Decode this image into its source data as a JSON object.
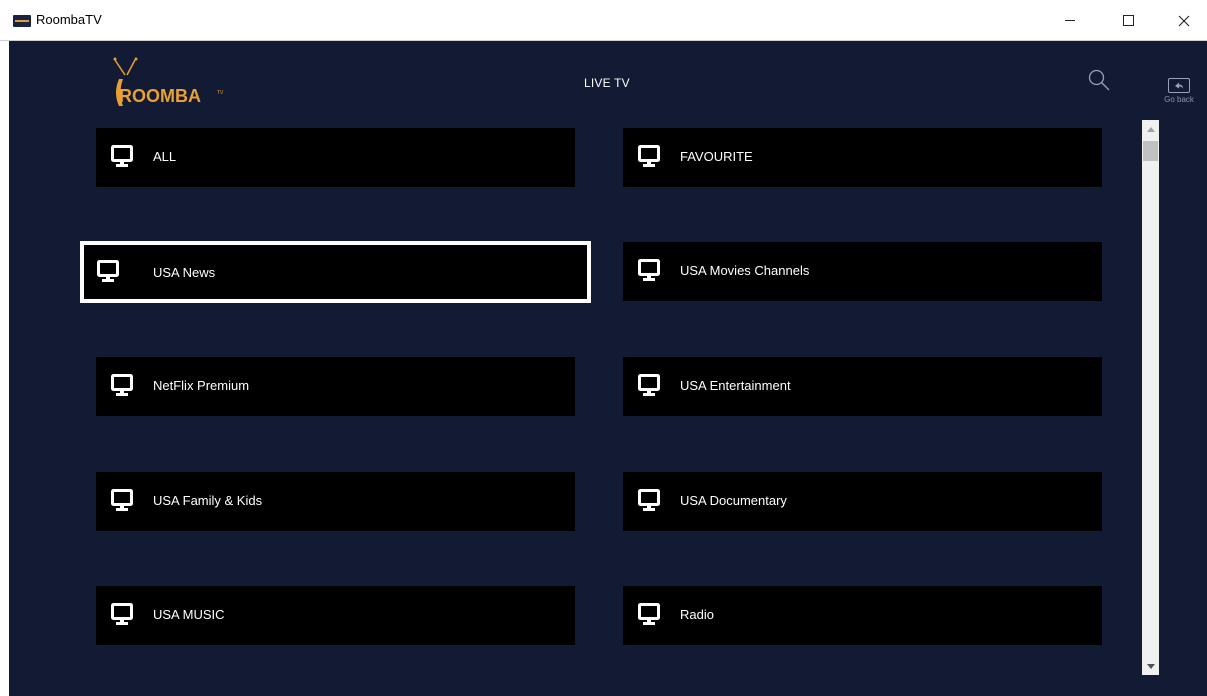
{
  "window": {
    "title": "RoombaTV"
  },
  "header": {
    "logo_text": "ROOMBA",
    "logo_tm": "TV",
    "title": "LIVE TV",
    "go_back_label": "Go back"
  },
  "categories": [
    {
      "label": "ALL",
      "focused": false
    },
    {
      "label": "FAVOURITE",
      "focused": false
    },
    {
      "label": "USA News",
      "focused": true
    },
    {
      "label": "USA Movies Channels",
      "focused": false
    },
    {
      "label": "NetFlix Premium",
      "focused": false
    },
    {
      "label": "USA Entertainment",
      "focused": false
    },
    {
      "label": "USA Family & Kids",
      "focused": false
    },
    {
      "label": "USA Documentary",
      "focused": false
    },
    {
      "label": "USA MUSIC",
      "focused": false
    },
    {
      "label": "Radio",
      "focused": false
    }
  ],
  "icons": {
    "category_icon": "monitor-icon",
    "search_icon": "search-icon",
    "back_icon": "back-arrow-icon"
  },
  "colors": {
    "background": "#131a33",
    "tile": "#000000",
    "focus_border": "#ffffff",
    "logo_orange": "#e8a035"
  }
}
